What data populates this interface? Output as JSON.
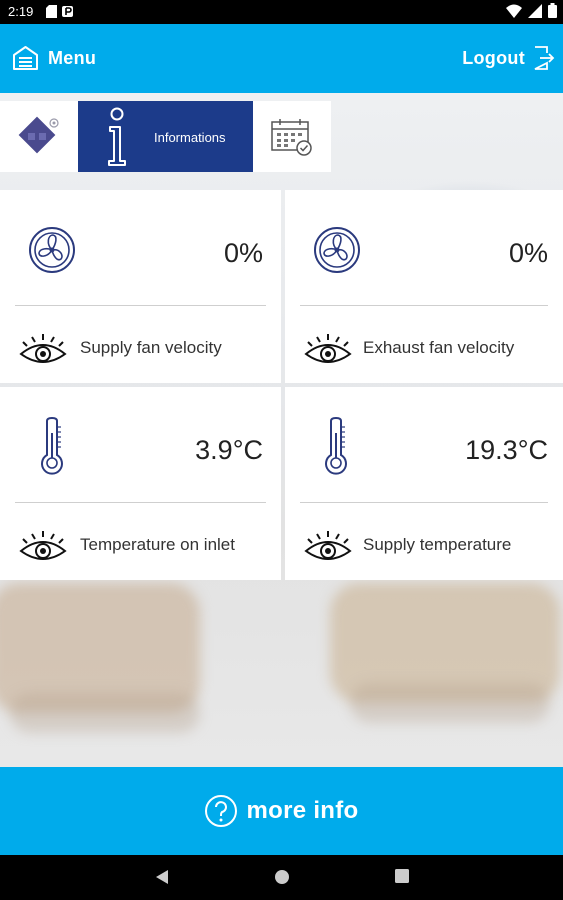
{
  "status_bar": {
    "time": "2:19"
  },
  "app_bar": {
    "menu_label": "Menu",
    "logout_label": "Logout"
  },
  "tabs": {
    "info_label": "Informations"
  },
  "cards": [
    {
      "value": "0%",
      "label": "Supply fan velocity",
      "icon": "fan-icon"
    },
    {
      "value": "0%",
      "label": "Exhaust fan velocity",
      "icon": "fan-icon"
    },
    {
      "value": "3.9°C",
      "label": "Temperature on inlet",
      "icon": "thermometer-icon"
    },
    {
      "value": "19.3°C",
      "label": "Supply temperature",
      "icon": "thermometer-icon"
    }
  ],
  "footer": {
    "more_info_label": "more info"
  },
  "colors": {
    "accent": "#00abeb",
    "tab_active": "#1c3b8a",
    "icon": "#2b3a7e"
  }
}
